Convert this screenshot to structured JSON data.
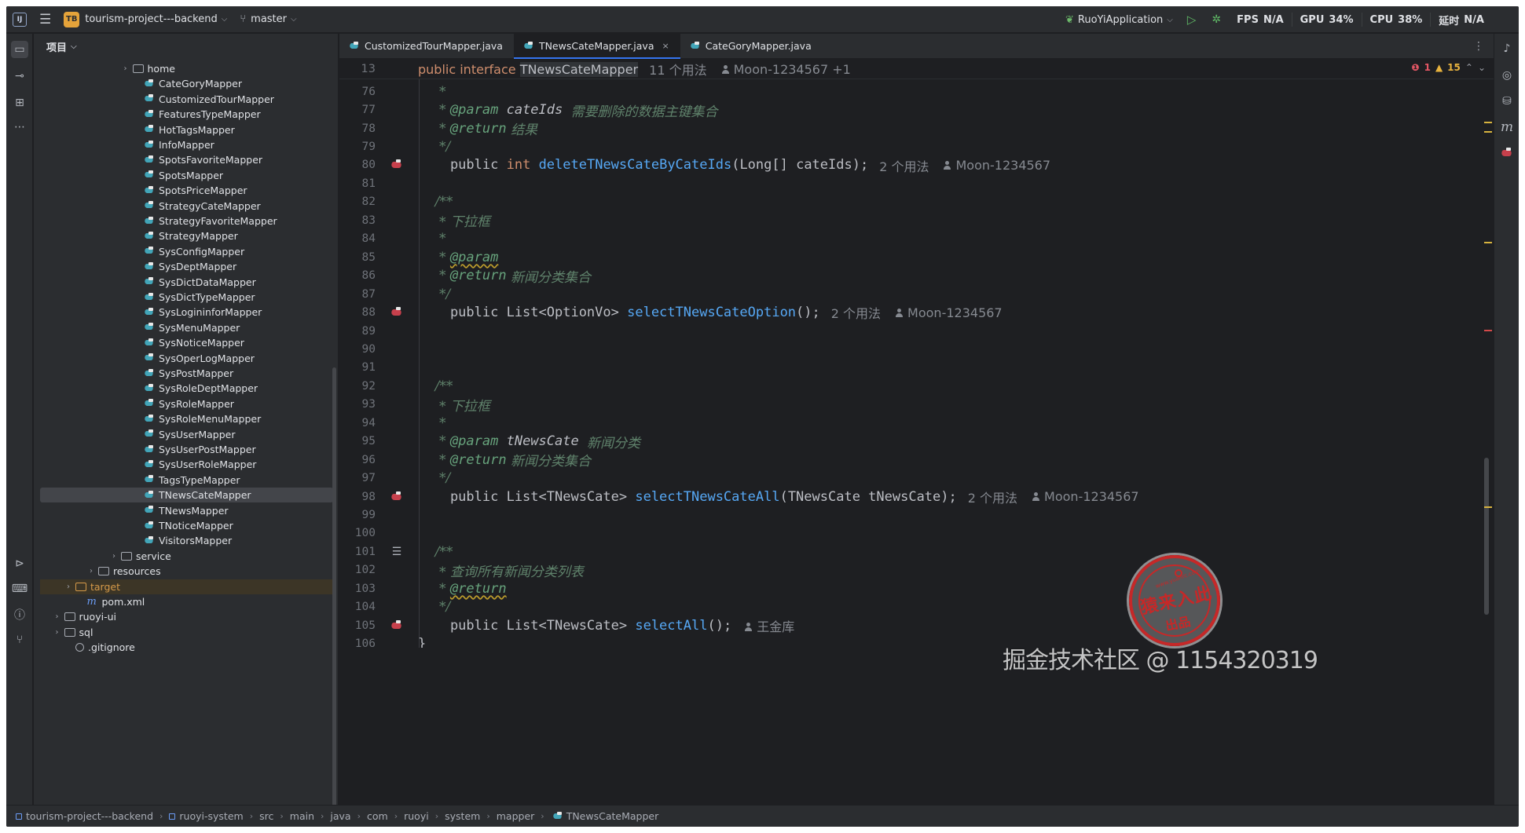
{
  "titlebar": {
    "app_logo": "IJ",
    "project_badge": "TB",
    "project_name": "tourism-project---backend",
    "branch": "master",
    "run_config": "RuoYiApplication",
    "stats": [
      {
        "label": "FPS",
        "value": "N/A"
      },
      {
        "label": "GPU",
        "value": "34%"
      },
      {
        "label": "CPU",
        "value": "38%"
      },
      {
        "label": "延时",
        "value": "N/A"
      }
    ]
  },
  "project_panel": {
    "title": "项目",
    "tree": [
      {
        "label": "home",
        "type": "folder",
        "indent": 7,
        "arrow": "›"
      },
      {
        "label": "CateGoryMapper",
        "type": "mapper",
        "indent": 8
      },
      {
        "label": "CustomizedTourMapper",
        "type": "mapper",
        "indent": 8
      },
      {
        "label": "FeaturesTypeMapper",
        "type": "mapper",
        "indent": 8
      },
      {
        "label": "HotTagsMapper",
        "type": "mapper",
        "indent": 8
      },
      {
        "label": "InfoMapper",
        "type": "mapper",
        "indent": 8
      },
      {
        "label": "SpotsFavoriteMapper",
        "type": "mapper",
        "indent": 8
      },
      {
        "label": "SpotsMapper",
        "type": "mapper",
        "indent": 8
      },
      {
        "label": "SpotsPriceMapper",
        "type": "mapper",
        "indent": 8
      },
      {
        "label": "StrategyCateMapper",
        "type": "mapper",
        "indent": 8
      },
      {
        "label": "StrategyFavoriteMapper",
        "type": "mapper",
        "indent": 8
      },
      {
        "label": "StrategyMapper",
        "type": "mapper",
        "indent": 8
      },
      {
        "label": "SysConfigMapper",
        "type": "mapper",
        "indent": 8
      },
      {
        "label": "SysDeptMapper",
        "type": "mapper",
        "indent": 8
      },
      {
        "label": "SysDictDataMapper",
        "type": "mapper",
        "indent": 8
      },
      {
        "label": "SysDictTypeMapper",
        "type": "mapper",
        "indent": 8
      },
      {
        "label": "SysLogininforMapper",
        "type": "mapper",
        "indent": 8
      },
      {
        "label": "SysMenuMapper",
        "type": "mapper",
        "indent": 8
      },
      {
        "label": "SysNoticeMapper",
        "type": "mapper",
        "indent": 8
      },
      {
        "label": "SysOperLogMapper",
        "type": "mapper",
        "indent": 8
      },
      {
        "label": "SysPostMapper",
        "type": "mapper",
        "indent": 8
      },
      {
        "label": "SysRoleDeptMapper",
        "type": "mapper",
        "indent": 8
      },
      {
        "label": "SysRoleMapper",
        "type": "mapper",
        "indent": 8
      },
      {
        "label": "SysRoleMenuMapper",
        "type": "mapper",
        "indent": 8
      },
      {
        "label": "SysUserMapper",
        "type": "mapper",
        "indent": 8
      },
      {
        "label": "SysUserPostMapper",
        "type": "mapper",
        "indent": 8
      },
      {
        "label": "SysUserRoleMapper",
        "type": "mapper",
        "indent": 8
      },
      {
        "label": "TagsTypeMapper",
        "type": "mapper",
        "indent": 8
      },
      {
        "label": "TNewsCateMapper",
        "type": "mapper",
        "indent": 8,
        "selected": true
      },
      {
        "label": "TNewsMapper",
        "type": "mapper",
        "indent": 8
      },
      {
        "label": "TNoticeMapper",
        "type": "mapper",
        "indent": 8
      },
      {
        "label": "VisitorsMapper",
        "type": "mapper",
        "indent": 8
      },
      {
        "label": "service",
        "type": "folder",
        "indent": 6,
        "arrow": "›"
      },
      {
        "label": "resources",
        "type": "folder",
        "indent": 4,
        "arrow": "›"
      },
      {
        "label": "target",
        "type": "folder-target",
        "indent": 2,
        "arrow": "›",
        "highlight": true
      },
      {
        "label": "pom.xml",
        "type": "maven",
        "indent": 3
      },
      {
        "label": "ruoyi-ui",
        "type": "folder",
        "indent": 1,
        "arrow": "›"
      },
      {
        "label": "sql",
        "type": "folder",
        "indent": 1,
        "arrow": "›"
      },
      {
        "label": ".gitignore",
        "type": "git",
        "indent": 2
      }
    ]
  },
  "editor": {
    "tabs": [
      {
        "label": "CustomizedTourMapper.java",
        "active": false
      },
      {
        "label": "TNewsCateMapper.java",
        "active": true,
        "close": "×"
      },
      {
        "label": "CateGoryMapper.java",
        "active": false
      }
    ],
    "sticky": {
      "line": "13",
      "kw1": "public",
      "kw2": "interface",
      "name": "TNewsCateMapper",
      "usages": "11 个用法",
      "author": "Moon-1234567 +1"
    },
    "inspections": {
      "errors": "1",
      "warnings": "15"
    },
    "lines": [
      {
        "n": "76",
        "kind": "doc",
        "parts": [
          {
            "c": "doc",
            "t": "     *"
          }
        ]
      },
      {
        "n": "77",
        "kind": "doc",
        "parts": [
          {
            "c": "doc",
            "t": "     * "
          },
          {
            "c": "doctag",
            "t": "@param"
          },
          {
            "c": "docparam",
            "t": " cateIds "
          },
          {
            "c": "doc",
            "t": "需要删除的数据主键集合"
          }
        ]
      },
      {
        "n": "78",
        "kind": "doc",
        "parts": [
          {
            "c": "doc",
            "t": "     * "
          },
          {
            "c": "doctag",
            "t": "@return"
          },
          {
            "c": "doc",
            "t": " 结果"
          }
        ]
      },
      {
        "n": "79",
        "kind": "doc",
        "parts": [
          {
            "c": "doc",
            "t": "     */"
          }
        ]
      },
      {
        "n": "80",
        "kind": "code",
        "gutter": "mapper",
        "parts": [
          {
            "c": "code-text",
            "t": "    public "
          },
          {
            "c": "kw",
            "t": "int"
          },
          {
            "c": "code-text",
            "t": " "
          },
          {
            "c": "fn",
            "t": "deleteTNewsCateByCateIds"
          },
          {
            "c": "code-text",
            "t": "(Long[] cateIds);"
          }
        ],
        "usages": "2 个用法",
        "author": "Moon-1234567"
      },
      {
        "n": "81",
        "kind": "blank",
        "parts": []
      },
      {
        "n": "82",
        "kind": "doc",
        "parts": [
          {
            "c": "doc",
            "t": "    /**"
          }
        ]
      },
      {
        "n": "83",
        "kind": "doc",
        "parts": [
          {
            "c": "doc",
            "t": "     * 下拉框"
          }
        ]
      },
      {
        "n": "84",
        "kind": "doc",
        "parts": [
          {
            "c": "doc",
            "t": "     *"
          }
        ]
      },
      {
        "n": "85",
        "kind": "doc",
        "parts": [
          {
            "c": "doc",
            "t": "     * "
          },
          {
            "c": "doctag warn",
            "t": "@param"
          }
        ]
      },
      {
        "n": "86",
        "kind": "doc",
        "parts": [
          {
            "c": "doc",
            "t": "     * "
          },
          {
            "c": "doctag",
            "t": "@return"
          },
          {
            "c": "doc",
            "t": " 新闻分类集合"
          }
        ]
      },
      {
        "n": "87",
        "kind": "doc",
        "parts": [
          {
            "c": "doc",
            "t": "     */"
          }
        ]
      },
      {
        "n": "88",
        "kind": "code",
        "gutter": "mapper",
        "parts": [
          {
            "c": "code-text",
            "t": "    public List<OptionVo> "
          },
          {
            "c": "fn",
            "t": "selectTNewsCateOption"
          },
          {
            "c": "code-text",
            "t": "();"
          }
        ],
        "usages": "2 个用法",
        "author": "Moon-1234567"
      },
      {
        "n": "89",
        "kind": "blank",
        "parts": []
      },
      {
        "n": "90",
        "kind": "blank",
        "parts": []
      },
      {
        "n": "91",
        "kind": "blank",
        "parts": []
      },
      {
        "n": "92",
        "kind": "doc",
        "parts": [
          {
            "c": "doc",
            "t": "    /**"
          }
        ]
      },
      {
        "n": "93",
        "kind": "doc",
        "parts": [
          {
            "c": "doc",
            "t": "     * 下拉框"
          }
        ]
      },
      {
        "n": "94",
        "kind": "doc",
        "parts": [
          {
            "c": "doc",
            "t": "     *"
          }
        ]
      },
      {
        "n": "95",
        "kind": "doc",
        "parts": [
          {
            "c": "doc",
            "t": "     * "
          },
          {
            "c": "doctag",
            "t": "@param"
          },
          {
            "c": "docparam",
            "t": " tNewsCate "
          },
          {
            "c": "doc",
            "t": "新闻分类"
          }
        ]
      },
      {
        "n": "96",
        "kind": "doc",
        "parts": [
          {
            "c": "doc",
            "t": "     * "
          },
          {
            "c": "doctag",
            "t": "@return"
          },
          {
            "c": "doc",
            "t": " 新闻分类集合"
          }
        ]
      },
      {
        "n": "97",
        "kind": "doc",
        "parts": [
          {
            "c": "doc",
            "t": "     */"
          }
        ]
      },
      {
        "n": "98",
        "kind": "code",
        "gutter": "mapper",
        "parts": [
          {
            "c": "code-text",
            "t": "    public List<TNewsCate> "
          },
          {
            "c": "fn",
            "t": "selectTNewsCateAll"
          },
          {
            "c": "code-text",
            "t": "(TNewsCate tNewsCate);"
          }
        ],
        "usages": "2 个用法",
        "author": "Moon-1234567"
      },
      {
        "n": "99",
        "kind": "blank",
        "parts": []
      },
      {
        "n": "100",
        "kind": "blank",
        "parts": []
      },
      {
        "n": "101",
        "kind": "doc",
        "gutter": "list",
        "parts": [
          {
            "c": "doc",
            "t": "    /**"
          }
        ]
      },
      {
        "n": "102",
        "kind": "doc",
        "parts": [
          {
            "c": "doc",
            "t": "     * 查询所有新闻分类列表"
          }
        ]
      },
      {
        "n": "103",
        "kind": "doc",
        "parts": [
          {
            "c": "doc",
            "t": "     * "
          },
          {
            "c": "doctag warn",
            "t": "@return"
          }
        ]
      },
      {
        "n": "104",
        "kind": "doc",
        "parts": [
          {
            "c": "doc",
            "t": "     */"
          }
        ]
      },
      {
        "n": "105",
        "kind": "code",
        "gutter": "mapper",
        "parts": [
          {
            "c": "code-text",
            "t": "    public List<TNewsCate> "
          },
          {
            "c": "fn",
            "t": "selectAll"
          },
          {
            "c": "code-text",
            "t": "();"
          }
        ],
        "author": "王金库"
      },
      {
        "n": "106",
        "kind": "code",
        "parts": [
          {
            "c": "code-text",
            "t": "}"
          }
        ]
      }
    ]
  },
  "statusbar": {
    "crumbs": [
      "tourism-project---backend",
      "ruoyi-system",
      "src",
      "main",
      "java",
      "com",
      "ruoyi",
      "system",
      "mapper",
      "TNewsCateMapper"
    ],
    "separator": "›"
  },
  "stamp": {
    "main": "猿来入此",
    "sub": "出品",
    "url": "www.yuanrc.com"
  },
  "watermark": "掘金技术社区 @ 1154320319"
}
